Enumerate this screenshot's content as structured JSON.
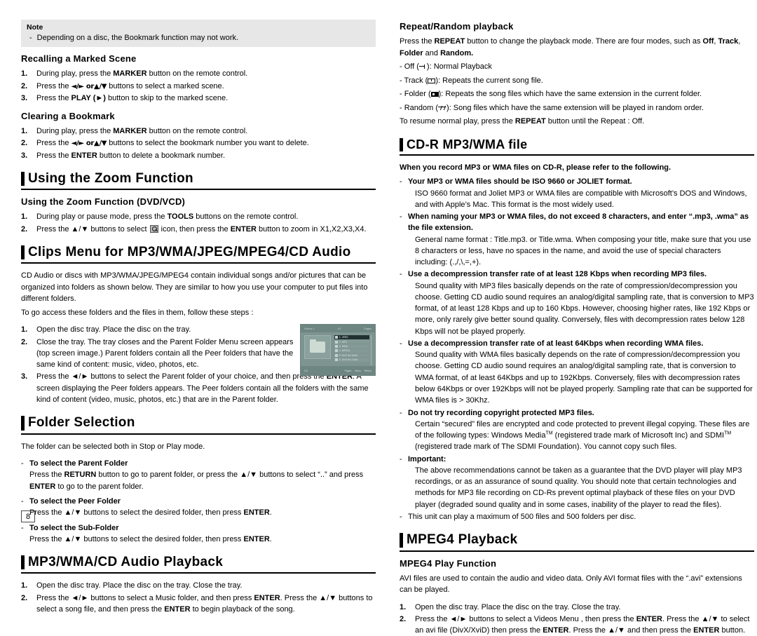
{
  "page": {
    "number": "8"
  },
  "left_column": {
    "note": {
      "title": "Note",
      "dash": "-",
      "text": "Depending on a disc, the Bookmark function may not work."
    },
    "recalling": {
      "heading": "Recalling a Marked Scene",
      "steps": [
        {
          "num": "1.",
          "pre": "During play, press the ",
          "bold": "MARKER",
          "post": " button on the remote control."
        },
        {
          "num": "2.",
          "pre": "Press the ",
          "bold": "◄/► or▲/▼",
          "post": " buttons to select a marked scene."
        },
        {
          "num": "3.",
          "pre": "Press the ",
          "bold": "PLAY (►)",
          "post": " button to skip to the marked scene."
        }
      ]
    },
    "clearing": {
      "heading": "Clearing a Bookmark",
      "steps": [
        {
          "num": "1.",
          "pre": "During play, press the ",
          "bold": "MARKER",
          "post": " button on the remote control."
        },
        {
          "num": "2.",
          "pre": "Press the ",
          "bold": "◄/► or▲/▼",
          "post": " buttons to select the bookmark number you want to delete."
        },
        {
          "num": "3.",
          "pre": "Press the ",
          "bold": "ENTER",
          "post": " button to delete a bookmark number."
        }
      ]
    },
    "zoom_section": {
      "title": "Using the Zoom Function",
      "sub_heading": "Using the Zoom Function (DVD/VCD)",
      "steps": [
        {
          "num": "1.",
          "pre": "During play or pause mode, press the ",
          "bold": "TOOLS",
          "post": " buttons on the remote control."
        },
        {
          "num": "2.",
          "pre": "Press the ▲/▼ buttons to select ",
          "mid": " icon, then press the ",
          "bold": "ENTER",
          "post": " button to zoom in X1,X2,X3,X4."
        }
      ]
    },
    "clips_section": {
      "title": "Clips Menu for MP3/WMA/JPEG/MPEG4/CD Audio",
      "intro": "CD Audio or discs with MP3/WMA/JPEG/MPEG4 contain individual songs and/or pictures that can be organized into folders as shown below. They are similar to how you use your computer to put files into different folders.",
      "intro2": "To go access these folders and the files in them, follow these steps :",
      "steps": [
        {
          "num": "1.",
          "text": "Open the disc tray. Place the disc on the tray."
        },
        {
          "num": "2.",
          "text": "Close the tray. The tray closes and the Parent Folder Menu screen appears (top screen image.) Parent folders contain all the Peer folders that have the same kind of content: music, video, photos, etc."
        },
        {
          "num": "3.",
          "pre": "Press the ◄/► buttons to select the Parent folder of your choice, and then press the ",
          "bold": "ENTER",
          "post": ". A screen displaying the Peer folders appears. The Peer folders contain all the folders with the same kind of content (video, music, photos, etc.) that are in the Parent folder."
        }
      ],
      "thumbnail": {
        "top_left": "Videos 1",
        "top_mid": "1/2",
        "top_right": "Pages",
        "rows": [
          {
            "index": "1",
            "name": "JPEG",
            "selected": true
          },
          {
            "index": "2",
            "name": "MP3",
            "selected": false
          },
          {
            "index": "3",
            "name": "WMA",
            "selected": false
          },
          {
            "index": "4",
            "name": "MPEG4",
            "selected": false
          },
          {
            "index": "5",
            "name": "DivX  Sel  Subtl",
            "selected": false
          },
          {
            "index": "6",
            "name": "DivX  No  Codec",
            "selected": false
          }
        ],
        "bottom_left": "CD",
        "bottom_items": [
          "Pages",
          "Menu",
          "Return"
        ]
      }
    },
    "folder_section": {
      "title": "Folder Selection",
      "intro": "The folder can be selected both in Stop or Play mode.",
      "items": [
        {
          "dash": "-",
          "heading": "To select the Parent Folder",
          "pre": "Press the ",
          "bold1": "RETURN",
          "mid": " button to go to parent folder, or press the ▲/▼ buttons to select “..” and press ",
          "bold2": "ENTER",
          "post": " to go to the parent folder."
        },
        {
          "dash": "-",
          "heading": "To select the Peer Folder",
          "pre": "Press the ▲/▼ buttons to select the desired folder, then press ",
          "bold1": "ENTER",
          "post": "."
        },
        {
          "dash": "-",
          "heading": "To select the Sub-Folder",
          "pre": "Press the ▲/▼ buttons to select the desired folder, then press ",
          "bold1": "ENTER",
          "post": "."
        }
      ]
    },
    "mp3_section": {
      "title": "MP3/WMA/CD Audio Playback",
      "steps": [
        {
          "num": "1.",
          "text": "Open the disc tray. Place the disc on the tray. Close the tray."
        },
        {
          "num": "2.",
          "pre": "Press the ◄/► buttons to select a Music folder, and then press ",
          "bold1": "ENTER",
          "mid": ". Press the ▲/▼ buttons to select a song file, and then press the ",
          "bold2": "ENTER",
          "post": " to begin playback of the song."
        }
      ]
    }
  },
  "right_column": {
    "repeat_section": {
      "heading": "Repeat/Random playback",
      "para_pre": "Press the ",
      "para_b1": "REPEAT",
      "para_mid": " button to change the playback mode. There are four modes, such as ",
      "para_b2": "Off",
      "para_mid2": ", ",
      "para_b3": "Track",
      "para_mid3": ", ",
      "para_b4": "Folder",
      "para_mid4": " and ",
      "para_b5": "Random.",
      "modes": [
        {
          "label": "- Off (",
          "close": "): Normal Playback",
          "icon": "off-icon"
        },
        {
          "label": "- Track (",
          "close": "): Repeats the current song file.",
          "icon": "track-icon"
        },
        {
          "label": "- Folder (",
          "close": "): Repeats the song files which have the same extension in the current folder.",
          "icon": "folder-icon"
        },
        {
          "label": "- Random (",
          "close": "): Song files which have the same extension will be played in random order.",
          "icon": "random-icon"
        }
      ],
      "resume_pre": "To resume normal play, press the ",
      "resume_bold": "REPEAT",
      "resume_post": " button until the Repeat : Off."
    },
    "cdr_section": {
      "title": "CD-R MP3/WMA file",
      "lead": "When you record MP3 or WMA files on CD-R, please refer to the following.",
      "items": [
        {
          "dash": "-",
          "heading": "Your MP3 or WMA files should be ISO 9660 or JOLIET format.",
          "body": "ISO 9660 format and Joliet MP3 or WMA files are compatible with Microsoft’s DOS and Windows, and with Apple’s Mac. This format is the most widely used."
        },
        {
          "dash": "-",
          "heading": "When naming your MP3 or WMA files, do not exceed 8 characters, and enter “.mp3, .wma” as the file extension.",
          "body": "General name format : Title.mp3. or Title.wma. When composing your title, make sure that you use 8 characters or less, have no spaces in the name, and avoid the use of special characters including: (.,/,\\,=,+)."
        },
        {
          "dash": "-",
          "heading": "Use a decompression transfer rate of at least 128 Kbps when recording MP3 files.",
          "body": "Sound quality with MP3 files basically depends on the rate of compression/decompression you choose. Getting CD audio sound requires an analog/digital sampling rate, that is conversion to MP3 format, of at least 128 Kbps and up to 160 Kbps. However, choosing higher rates, like 192 Kbps or more, only rarely give better sound quality. Conversely, files with decompression rates below 128 Kbps will not be played  properly."
        },
        {
          "dash": "-",
          "heading": "Use a decompression transfer rate of at least 64Kbps when recording WMA files.",
          "body": "Sound quality with WMA files basically depends on the rate of compression/decompression you choose. Getting CD audio sound requires an analog/digital sampling rate, that is conversion to WMA format, of at least 64Kbps and up to 192Kbps. Conversely, files with decompression rates below 64Kbps or over 192Kbps will not be played    properly. Sampling rate that can be supported for WMA files is > 30Khz."
        },
        {
          "dash": "-",
          "heading": "Do not try recording copyright protected MP3 files.",
          "body_pre": "Certain “secured” files are encrypted and code protected to prevent illegal copying. These files are of the following types: Windows Media",
          "tm1": "TM",
          "body_mid": " (registered trade mark of Microsoft Inc) and SDMI",
          "tm2": "TM",
          "body_post": " (registered trade mark of The SDMI Foundation). You cannot copy such files."
        },
        {
          "dash": "-",
          "heading": "Important:",
          "body": "The above recommendations cannot be taken as a guarantee that the DVD player will play MP3 recordings, or as an assurance of sound quality. You should note that certain technologies and methods for MP3 file recording on CD-Rs prevent optimal playback of these files on your DVD player (degraded sound quality and in some cases, inability of the player to read the files)."
        }
      ],
      "last_dash": "-",
      "last_line": "This unit can play a maximum of 500 files and 500 folders per disc."
    },
    "mpeg4_section": {
      "title": "MPEG4 Playback",
      "sub_heading": "MPEG4 Play Function",
      "intro": "AVI files are used to contain the audio and video data. Only AVI format files with the “.avi” extensions can be played.",
      "steps": [
        {
          "num": "1.",
          "text": "Open the disc tray. Place the disc on the tray.  Close the tray."
        },
        {
          "num": "2.",
          "pre": "Press the ◄/► buttons to select a Videos Menu , then press the ",
          "bold1": "ENTER",
          "mid": ". Press the ▲/▼ to select an avi file (DivX/XviD) then press the ",
          "bold2": "ENTER",
          "mid2": ". Press the ▲/▼ and then press the ",
          "bold3": "ENTER",
          "post": " button."
        }
      ]
    }
  }
}
